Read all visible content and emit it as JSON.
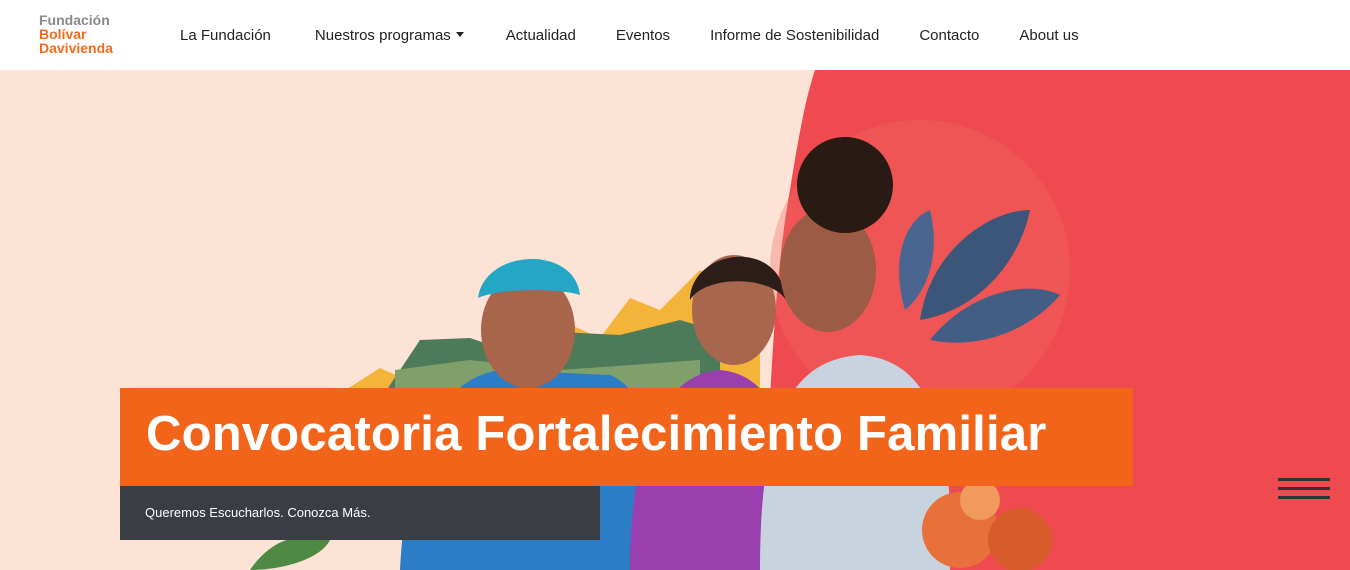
{
  "logo": {
    "line1": "Fundación",
    "line2": "Bolívar",
    "line3": "Davivienda"
  },
  "nav": [
    {
      "label": "La Fundación"
    },
    {
      "label": "Nuestros programas",
      "dropdown": true
    },
    {
      "label": "Actualidad"
    },
    {
      "label": "Eventos"
    },
    {
      "label": "Informe de Sostenibilidad"
    },
    {
      "label": "Contacto"
    },
    {
      "label": "About us"
    }
  ],
  "hero": {
    "title": "Convocatoria Fortalecimiento Familiar",
    "subtitle": "Queremos Escucharlos. Conozca Más.",
    "menu_icon": "hamburger-icon"
  },
  "colors": {
    "brand_orange": "#f26419",
    "brand_grey": "#8a8a8a",
    "hero_bg": "#fde3d6",
    "hero_red": "#ef4a4f",
    "dark_box": "#3a3d44"
  }
}
